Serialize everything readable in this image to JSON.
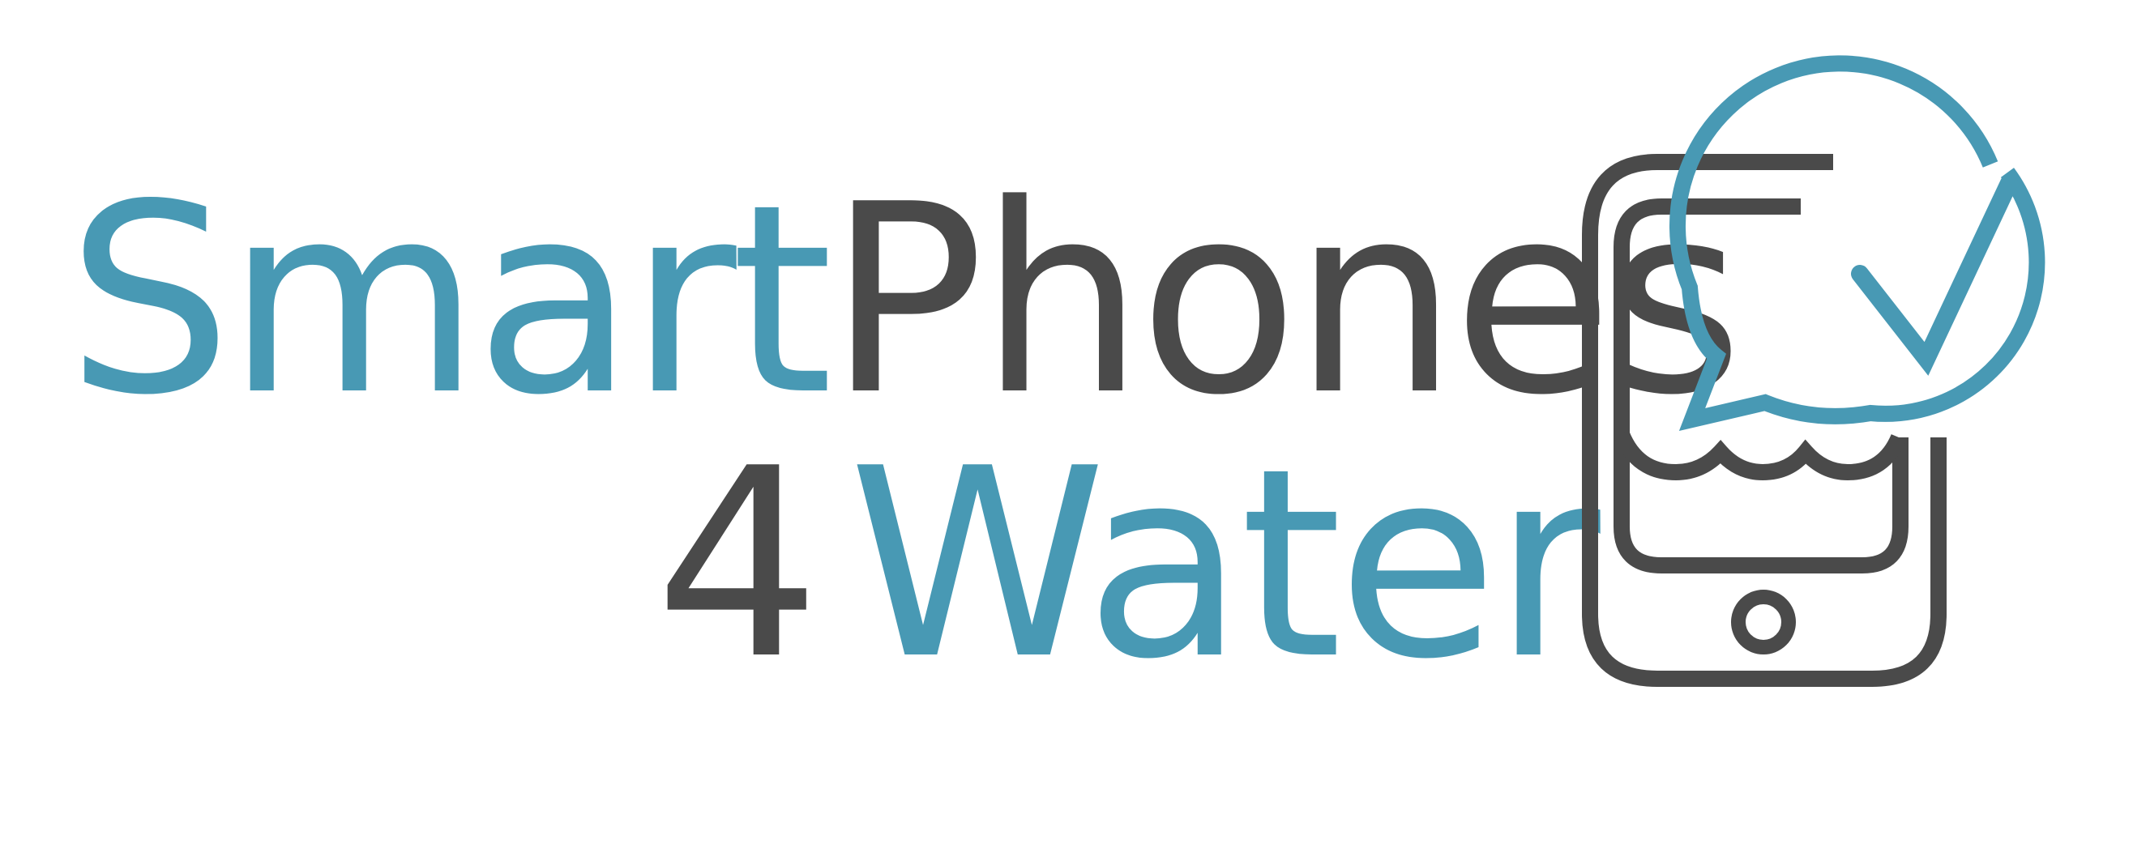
{
  "logo": {
    "line1": {
      "part1": "Smart",
      "part2": "Phones"
    },
    "line2": {
      "part1": "4",
      "part2": "Water"
    },
    "colors": {
      "teal": "#4899b4",
      "grey": "#4a4a4a",
      "background": "#ffffff"
    },
    "icon": "smartphone-water-checkmark-icon"
  }
}
